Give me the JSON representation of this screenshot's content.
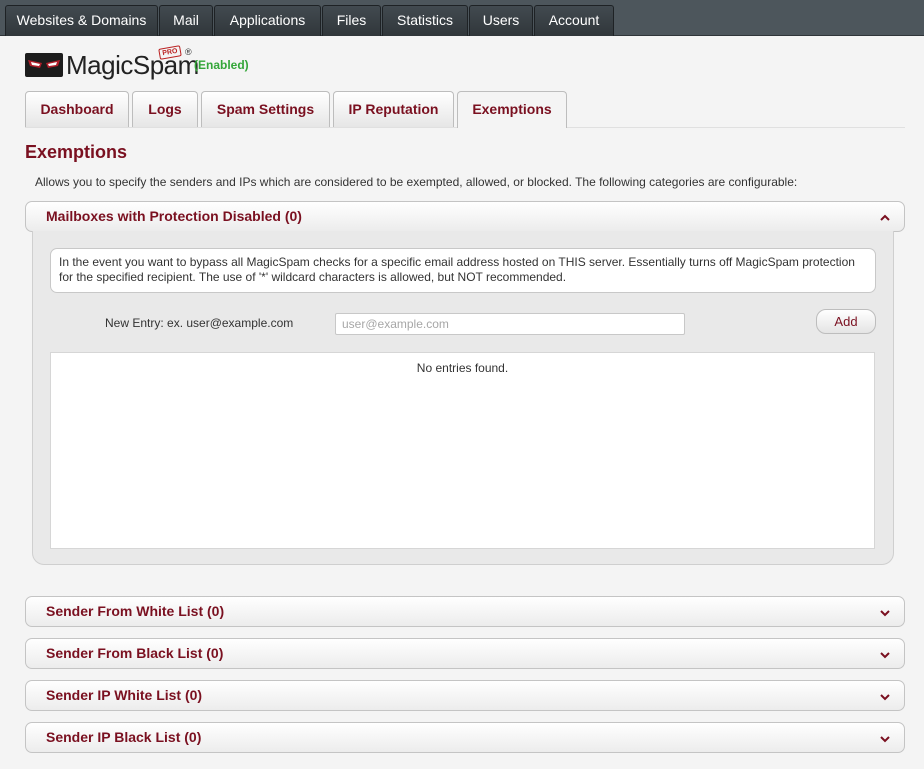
{
  "topnav": {
    "tabs": [
      "Websites & Domains",
      "Mail",
      "Applications",
      "Files",
      "Statistics",
      "Users",
      "Account"
    ]
  },
  "logo": {
    "brand": "MagicSpam",
    "badge": "PRO",
    "reg": "®",
    "status": "(Enabled)"
  },
  "subtabs": {
    "items": [
      "Dashboard",
      "Logs",
      "Spam Settings",
      "IP Reputation",
      "Exemptions"
    ],
    "active": "Exemptions"
  },
  "page": {
    "title": "Exemptions",
    "description": "Allows you to specify the senders and IPs which are considered to be exempted, allowed, or blocked. The following categories are configurable:"
  },
  "sections": {
    "mailboxes": {
      "title": "Mailboxes with Protection Disabled (0)",
      "info": "In the event you want to bypass all MagicSpam checks for a specific email address hosted on THIS server. Essentially turns off MagicSpam protection for the specified recipient. The use of '*' wildcard characters is allowed, but NOT recommended.",
      "new_entry_label": "New Entry: ex. user@example.com",
      "input_value": "",
      "input_placeholder": "user@example.com",
      "add_label": "Add",
      "empty_text": "No entries found."
    },
    "sender_white": {
      "title": "Sender From White List (0)"
    },
    "sender_black": {
      "title": "Sender From Black List (0)"
    },
    "ip_white": {
      "title": "Sender IP White List (0)"
    },
    "ip_black": {
      "title": "Sender IP Black List (0)"
    }
  },
  "icons": {
    "expanded": "chevron-up-icon",
    "collapsed": "chevron-down-icon"
  },
  "colors": {
    "accent": "#7a1020",
    "enabled": "#34a639",
    "nav_bg": "#4d565c"
  }
}
